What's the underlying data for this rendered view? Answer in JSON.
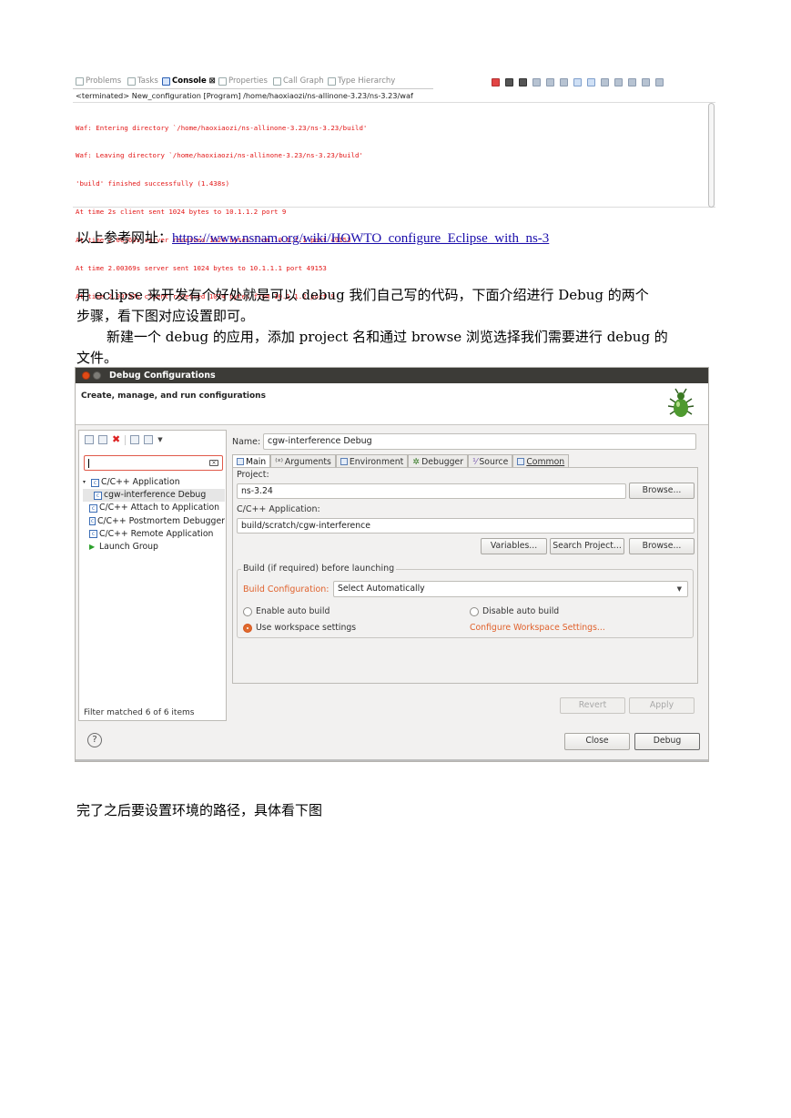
{
  "console": {
    "tabs": [
      {
        "label": "Problems",
        "active": false
      },
      {
        "label": "Tasks",
        "active": false
      },
      {
        "label": "Console ⊠",
        "active": true
      },
      {
        "label": "Properties",
        "active": false
      },
      {
        "label": "Call Graph",
        "active": false
      },
      {
        "label": "Type Hierarchy",
        "active": false
      }
    ],
    "path": "<terminated> New_configuration [Program] /home/haoxiaozi/ns-allinone-3.23/ns-3.23/waf",
    "lines": [
      "Waf: Entering directory `/home/haoxiaozi/ns-allinone-3.23/ns-3.23/build'",
      "Waf: Leaving directory `/home/haoxiaozi/ns-allinone-3.23/ns-3.23/build'",
      "'build' finished successfully (1.438s)",
      "At time 2s client sent 1024 bytes to 10.1.1.2 port 9",
      "At time 2.00369s server received 1024 bytes from 10.1.1.1 port 49153",
      "At time 2.00369s server sent 1024 bytes to 10.1.1.1 port 49153",
      "At time 2.00737s client received 1024 bytes from 10.1.1.2 port 9"
    ],
    "text_color": "#e21515"
  },
  "text": {
    "ref_prefix": "以上参考网址：",
    "ref_link": "https://www.nsnam.org/wiki/HOWTO_configure_Eclipse_with_ns-3",
    "para1_line1": "用 eclipse 来开发有个好处就是可以 debug 我们自己写的代码，下面介绍进行 Debug  的两个",
    "para1_line2": "步骤，看下图对应设置即可。",
    "para2_line1": "新建一个 debug 的应用，添加 project 名和通过 browse 浏览选择我们需要进行 debug 的",
    "para2_line2": "文件。",
    "para3": "完了之后要设置环境的路径，具体看下图"
  },
  "dialog": {
    "title": "Debug Configurations",
    "header": "Create, manage, and run configurations",
    "tree": [
      {
        "label": "C/C++ Application",
        "level": 0,
        "expanded": true
      },
      {
        "label": "cgw-interference Debug",
        "level": 1,
        "selected": true
      },
      {
        "label": "C/C++ Attach to Application",
        "level": 0
      },
      {
        "label": "C/C++ Postmortem Debugger",
        "level": 0
      },
      {
        "label": "C/C++ Remote Application",
        "level": 0
      },
      {
        "label": "Launch Group",
        "level": 0
      }
    ],
    "filter_status": "Filter matched 6 of 6 items",
    "name_label": "Name:",
    "name_value": "cgw-interference Debug",
    "tabs": [
      {
        "label": "Main",
        "active": true
      },
      {
        "label": "Arguments",
        "active": false
      },
      {
        "label": "Environment",
        "active": false
      },
      {
        "label": "Debugger",
        "active": false
      },
      {
        "label": "Source",
        "active": false
      },
      {
        "label": "Common",
        "active": false
      }
    ],
    "project_label": "Project:",
    "project_value": "ns-3.24",
    "browse_label": "Browse...",
    "app_label": "C/C++ Application:",
    "app_value": "build/scratch/cgw-interference",
    "variables_label": "Variables...",
    "search_label": "Search Project...",
    "browse2_label": "Browse...",
    "build_group_title": "Build (if required) before launching",
    "build_config_label": "Build Configuration:",
    "build_config_value": "Select Automatically",
    "enable_auto": "Enable auto build",
    "disable_auto": "Disable auto build",
    "use_workspace": "Use workspace settings",
    "configure_workspace": "Configure Workspace Settings...",
    "revert_label": "Revert",
    "apply_label": "Apply",
    "close_label": "Close",
    "debug_label": "Debug",
    "help_symbol": "?",
    "accent_color": "#e0622d"
  }
}
